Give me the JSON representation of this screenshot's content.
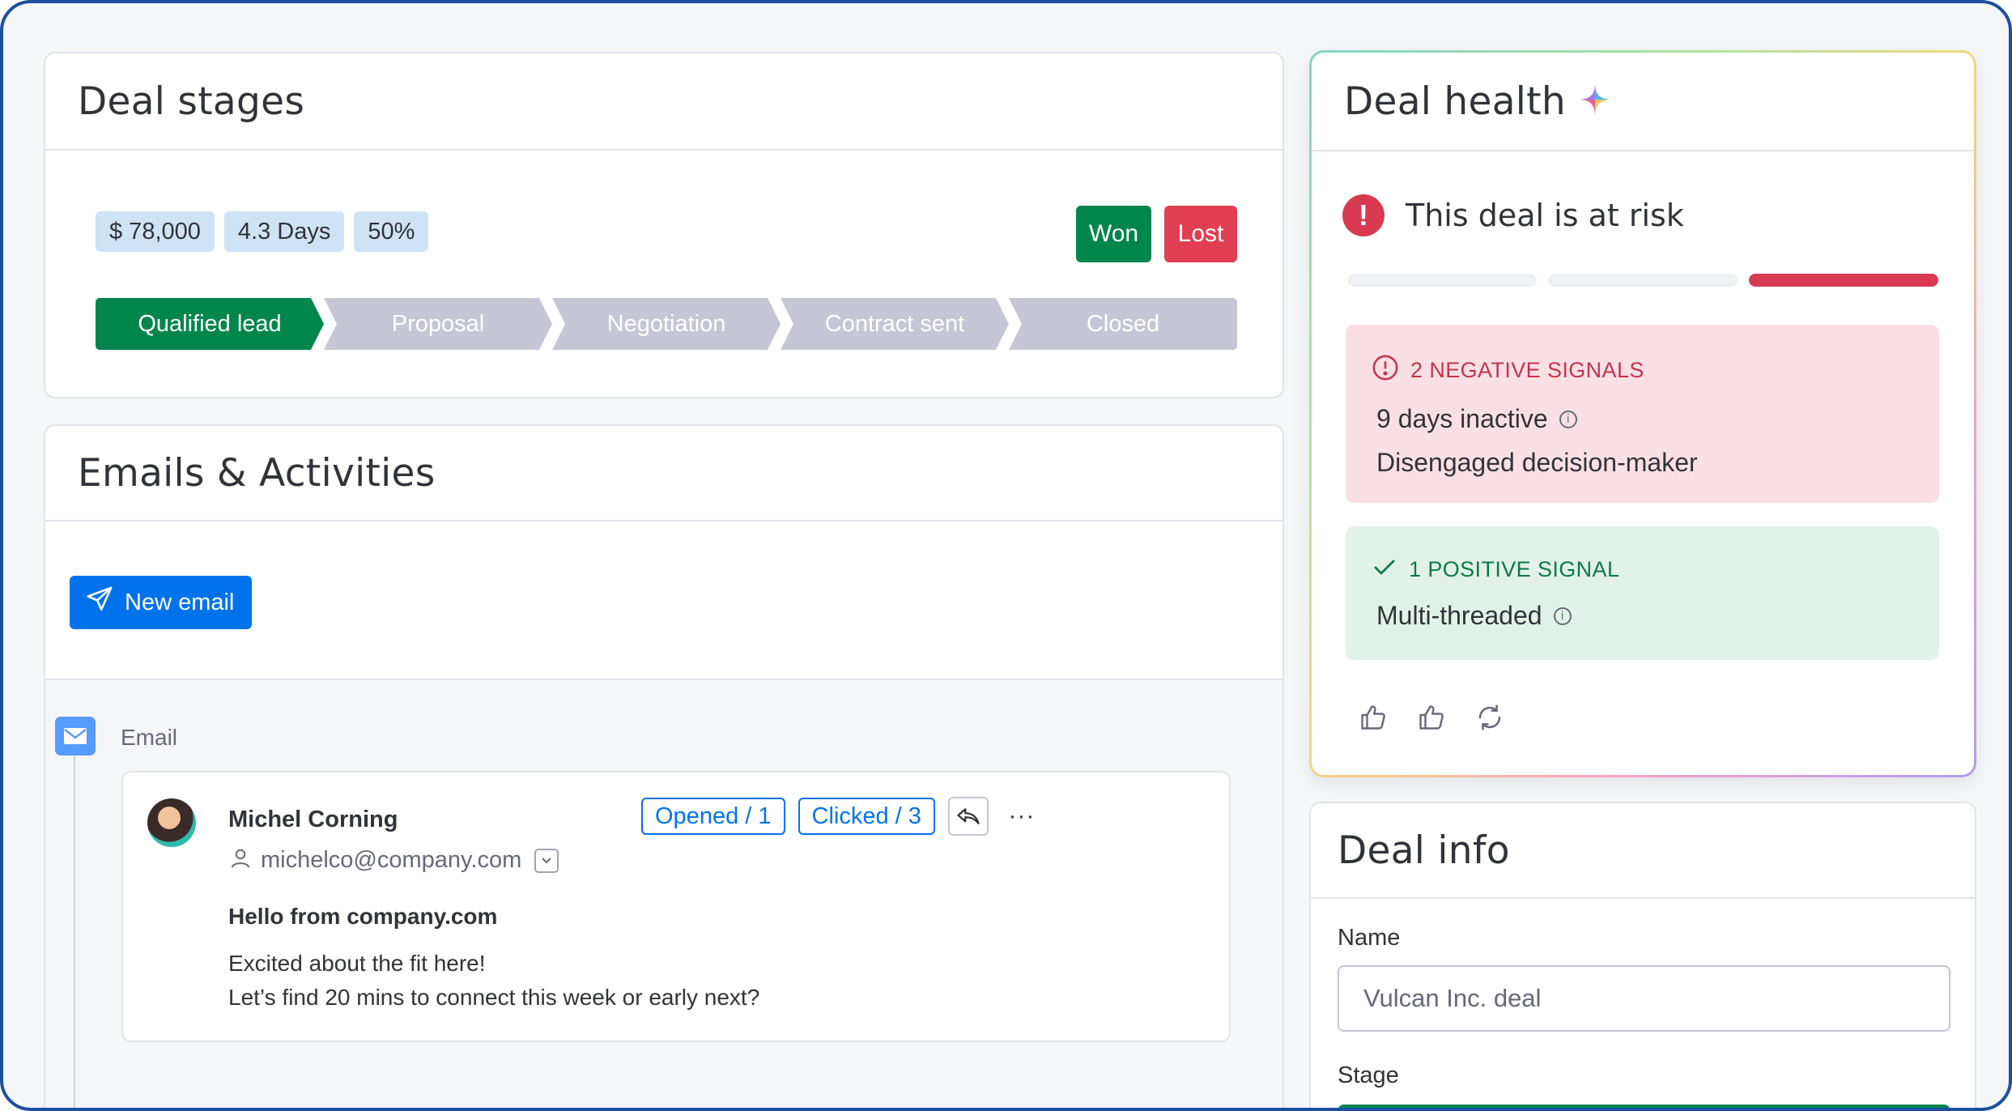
{
  "deal_stages": {
    "title": "Deal stages",
    "badges": [
      "$ 78,000",
      "4.3 Days",
      "50%"
    ],
    "won_label": "Won",
    "lost_label": "Lost",
    "stages": [
      "Qualified lead",
      "Proposal",
      "Negotiation",
      "Contract sent",
      "Closed"
    ],
    "active_stage": "Qualified lead"
  },
  "emails": {
    "title": "Emails & Activities",
    "new_email_label": "New email",
    "activity_type": "Email",
    "item": {
      "sender_name": "Michel Corning",
      "sender_email": "michelco@company.com",
      "opened_tag": "Opened / 1",
      "clicked_tag": "Clicked / 3",
      "more": "···",
      "subject": "Hello from company.com",
      "body_lines": [
        "Excited about the fit here!",
        "Let’s find 20 mins to connect this week or early next?"
      ]
    }
  },
  "deal_health": {
    "title": "Deal health",
    "status": "This deal is at risk",
    "risk_level": "3 of 3 segments (high)",
    "negative": {
      "heading": "2 NEGATIVE SIGNALS",
      "items": [
        "9 days inactive",
        "Disengaged decision-maker"
      ]
    },
    "positive": {
      "heading": "1 POSITIVE SIGNAL",
      "items": [
        "Multi-threaded"
      ]
    }
  },
  "deal_info": {
    "title": "Deal info",
    "name_label": "Name",
    "name_value": "Vulcan Inc. deal",
    "stage_label": "Stage"
  },
  "colors": {
    "primary": "#0073ea",
    "won": "#00854d",
    "lost": "#e03e52",
    "risk": "#d83a52",
    "frame_border": "#1d4fa0"
  }
}
